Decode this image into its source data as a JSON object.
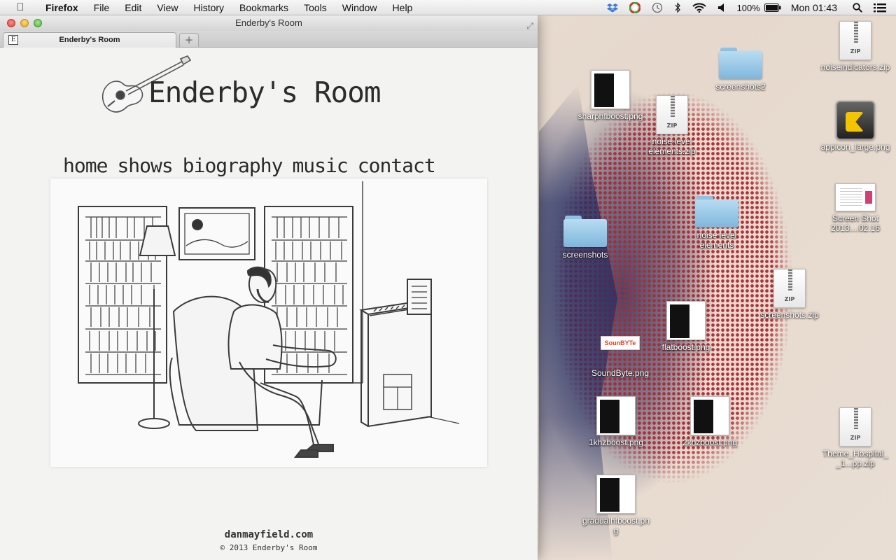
{
  "menubar": {
    "app_name": "Firefox",
    "menus": [
      "File",
      "Edit",
      "View",
      "History",
      "Bookmarks",
      "Tools",
      "Window",
      "Help"
    ],
    "battery": "100%",
    "clock": "Mon 01:43"
  },
  "window": {
    "title": "Enderby's Room",
    "tab_title": "Enderby's Room",
    "tab_favicon": "E",
    "new_tab": "+"
  },
  "site": {
    "title": "Enderby's Room",
    "nav": [
      "home",
      "shows",
      "biography",
      "music",
      "contact"
    ],
    "footer_url": "danmayfield.com",
    "footer_copy": "© 2013 Enderby's Room"
  },
  "desktop": {
    "icons": [
      {
        "label": "noiseindicators.zip",
        "type": "zip"
      },
      {
        "label": "screenshots2",
        "type": "folder"
      },
      {
        "label": "sharphfboost.png",
        "type": "screenshot"
      },
      {
        "label": "noise level elements.zip",
        "type": "zip"
      },
      {
        "label": "appicon_large.png",
        "type": "app-icon"
      },
      {
        "label": "Screen Shot 2013....02.16",
        "type": "screenshot"
      },
      {
        "label": "noise level elements",
        "type": "folder"
      },
      {
        "label": "screenshots",
        "type": "folder"
      },
      {
        "label": "screenshots.zip",
        "type": "zip"
      },
      {
        "label": "flatboost.png",
        "type": "screenshot"
      },
      {
        "label": "SoundByte.png",
        "type": "image"
      },
      {
        "label": "1khzboost.png",
        "type": "screenshot"
      },
      {
        "label": "2khzboost.png",
        "type": "screenshot"
      },
      {
        "label": "Theme_Hospital__1...pp.zip",
        "type": "zip"
      },
      {
        "label": "gradualhfboost.png",
        "type": "screenshot"
      }
    ],
    "soundbyte_logo": "SounBYTe",
    "zip_badge": "ZIP"
  }
}
